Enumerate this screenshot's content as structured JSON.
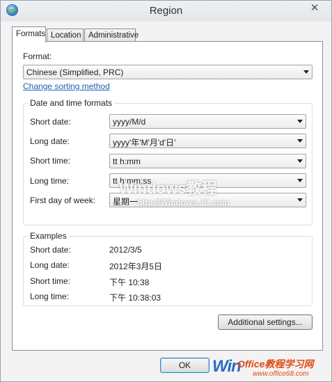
{
  "window": {
    "title": "Region",
    "close_glyph": "✕"
  },
  "tabs": [
    {
      "label": "Formats",
      "active": true
    },
    {
      "label": "Location",
      "active": false
    },
    {
      "label": "Administrative",
      "active": false
    }
  ],
  "formats": {
    "format_label": "Format:",
    "format_value": "Chinese (Simplified, PRC)",
    "change_sorting_link": "Change sorting method",
    "datetime_group": {
      "title": "Date and time formats",
      "rows": [
        {
          "label": "Short date:",
          "value": "yyyy/M/d"
        },
        {
          "label": "Long date:",
          "value": "yyyy'年'M'月'd'日'"
        },
        {
          "label": "Short time:",
          "value": "tt h:mm"
        },
        {
          "label": "Long time:",
          "value": "tt h:mm:ss"
        },
        {
          "label": "First day of week:",
          "value": "星期一"
        }
      ]
    },
    "examples_group": {
      "title": "Examples",
      "rows": [
        {
          "label": "Short date:",
          "value": "2012/3/5"
        },
        {
          "label": "Long date:",
          "value": "2012年3月5日"
        },
        {
          "label": "Short time:",
          "value": "下午 10:38"
        },
        {
          "label": "Long time:",
          "value": "下午 10:38:03"
        }
      ]
    },
    "additional_settings_button": "Additional settings..."
  },
  "buttons": {
    "ok": "OK"
  },
  "watermarks": {
    "center_text": "Windows教程",
    "center_url": "http://Windows.JC.com",
    "corner_win": "Win",
    "corner_brand": "Office教程学习网",
    "corner_url": "www.office68.com"
  },
  "colors": {
    "link": "#1e5fae",
    "default_button_border": "#3c7fb1",
    "panel_border": "#8e8f8f"
  }
}
